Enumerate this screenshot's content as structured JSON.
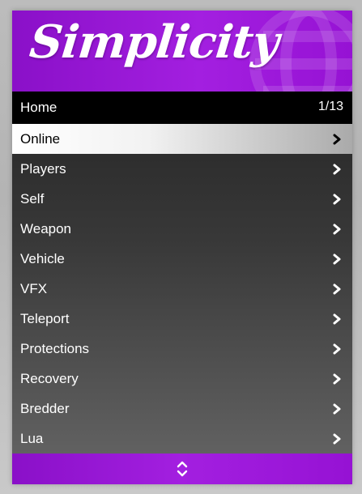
{
  "brand": {
    "logo_text": "Simplicity",
    "accent_color": "#a31fe0"
  },
  "header": {
    "title": "Home",
    "counter": "1/13"
  },
  "menu": {
    "selected_index": 0,
    "items": [
      {
        "label": "Online",
        "icon": "chevron-right-icon"
      },
      {
        "label": "Players",
        "icon": "chevron-right-icon"
      },
      {
        "label": "Self",
        "icon": "chevron-right-icon"
      },
      {
        "label": "Weapon",
        "icon": "chevron-right-icon"
      },
      {
        "label": "Vehicle",
        "icon": "chevron-right-icon"
      },
      {
        "label": "VFX",
        "icon": "chevron-right-icon"
      },
      {
        "label": "Teleport",
        "icon": "chevron-right-icon"
      },
      {
        "label": "Protections",
        "icon": "chevron-right-icon"
      },
      {
        "label": "Recovery",
        "icon": "chevron-right-icon"
      },
      {
        "label": "Bredder",
        "icon": "chevron-right-icon"
      },
      {
        "label": "Lua",
        "icon": "chevron-right-icon"
      }
    ]
  },
  "footer": {
    "icon": "up-down-arrows-icon"
  }
}
